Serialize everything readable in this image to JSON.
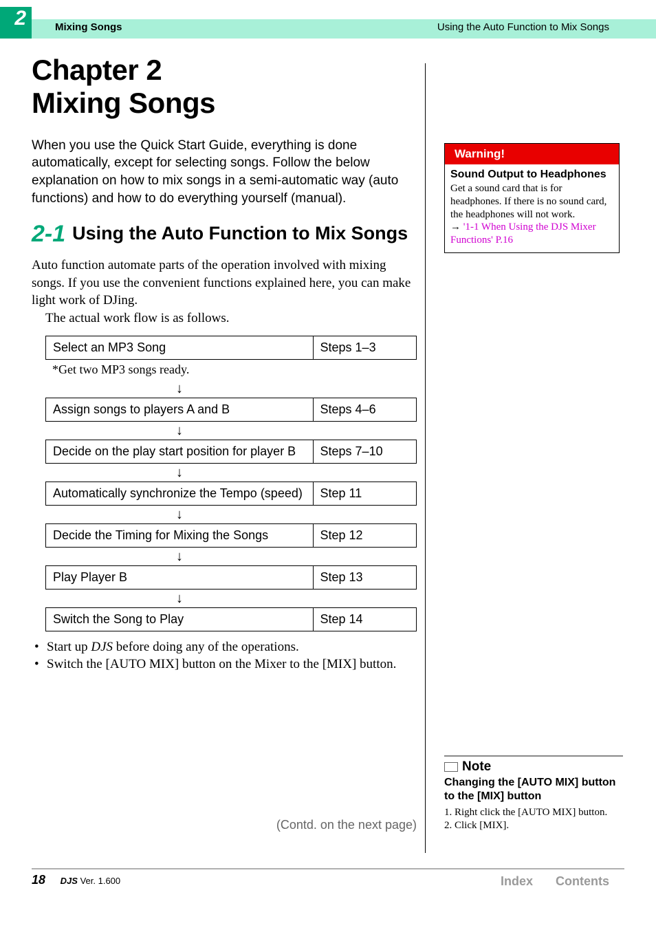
{
  "header": {
    "chapter_tab": "2",
    "left_text": "Mixing Songs",
    "right_text": "Using the Auto Function to Mix Songs"
  },
  "chapter": {
    "title_line1": "Chapter 2",
    "title_line2": "Mixing Songs",
    "intro": "When you use the Quick Start Guide, everything is done automatically, except for selecting songs. Follow the below explanation on how to mix songs in a semi-automatic way (auto functions) and how to do everything yourself (manual)."
  },
  "section": {
    "number": "2-1",
    "title": "Using the Auto Function to Mix Songs",
    "body1": "Auto function automate parts of the operation involved with mixing songs. If you use the convenient functions explained here, you can make light work of DJing.",
    "body2": "The actual work flow is as follows."
  },
  "flow": {
    "row1": {
      "task": "Select an MP3 Song",
      "steps": "Steps 1–3"
    },
    "note": "*Get two MP3 songs ready.",
    "row2": {
      "task": "Assign songs to players A and B",
      "steps": "Steps 4–6"
    },
    "row3": {
      "task": "Decide on the play start position for player B",
      "steps": "Steps 7–10"
    },
    "row4": {
      "task": "Automatically synchronize the Tempo (speed)",
      "steps": "Step 11"
    },
    "row5": {
      "task": "Decide the Timing for Mixing the Songs",
      "steps": "Step 12"
    },
    "row6": {
      "task": "Play Player B",
      "steps": "Step 13"
    },
    "row7": {
      "task": "Switch the Song to Play",
      "steps": "Step 14"
    }
  },
  "bullets": {
    "b1_pre": "Start up ",
    "b1_em": "DJS",
    "b1_post": " before doing any of the operations.",
    "b2": "Switch the [AUTO MIX] button on the Mixer to the [MIX] button."
  },
  "contd": "(Contd. on the next page)",
  "warning": {
    "head": "Warning!",
    "sub": "Sound Output to Headphones",
    "body": "Get a sound card that is for headphones. If there is no sound card, the headphones will not work.",
    "arrow": "→",
    "link": "'1-1 When Using the DJS Mixer Functions' P.16"
  },
  "note": {
    "head": "Note",
    "sub": "Changing the [AUTO MIX] button to the [MIX] button",
    "step1": "1. Right click the [AUTO MIX] button.",
    "step2": "2. Click [MIX]."
  },
  "footer": {
    "page": "18",
    "product": "DJS",
    "version_label": "Ver. 1.600",
    "link_index": "Index",
    "link_contents": "Contents"
  }
}
